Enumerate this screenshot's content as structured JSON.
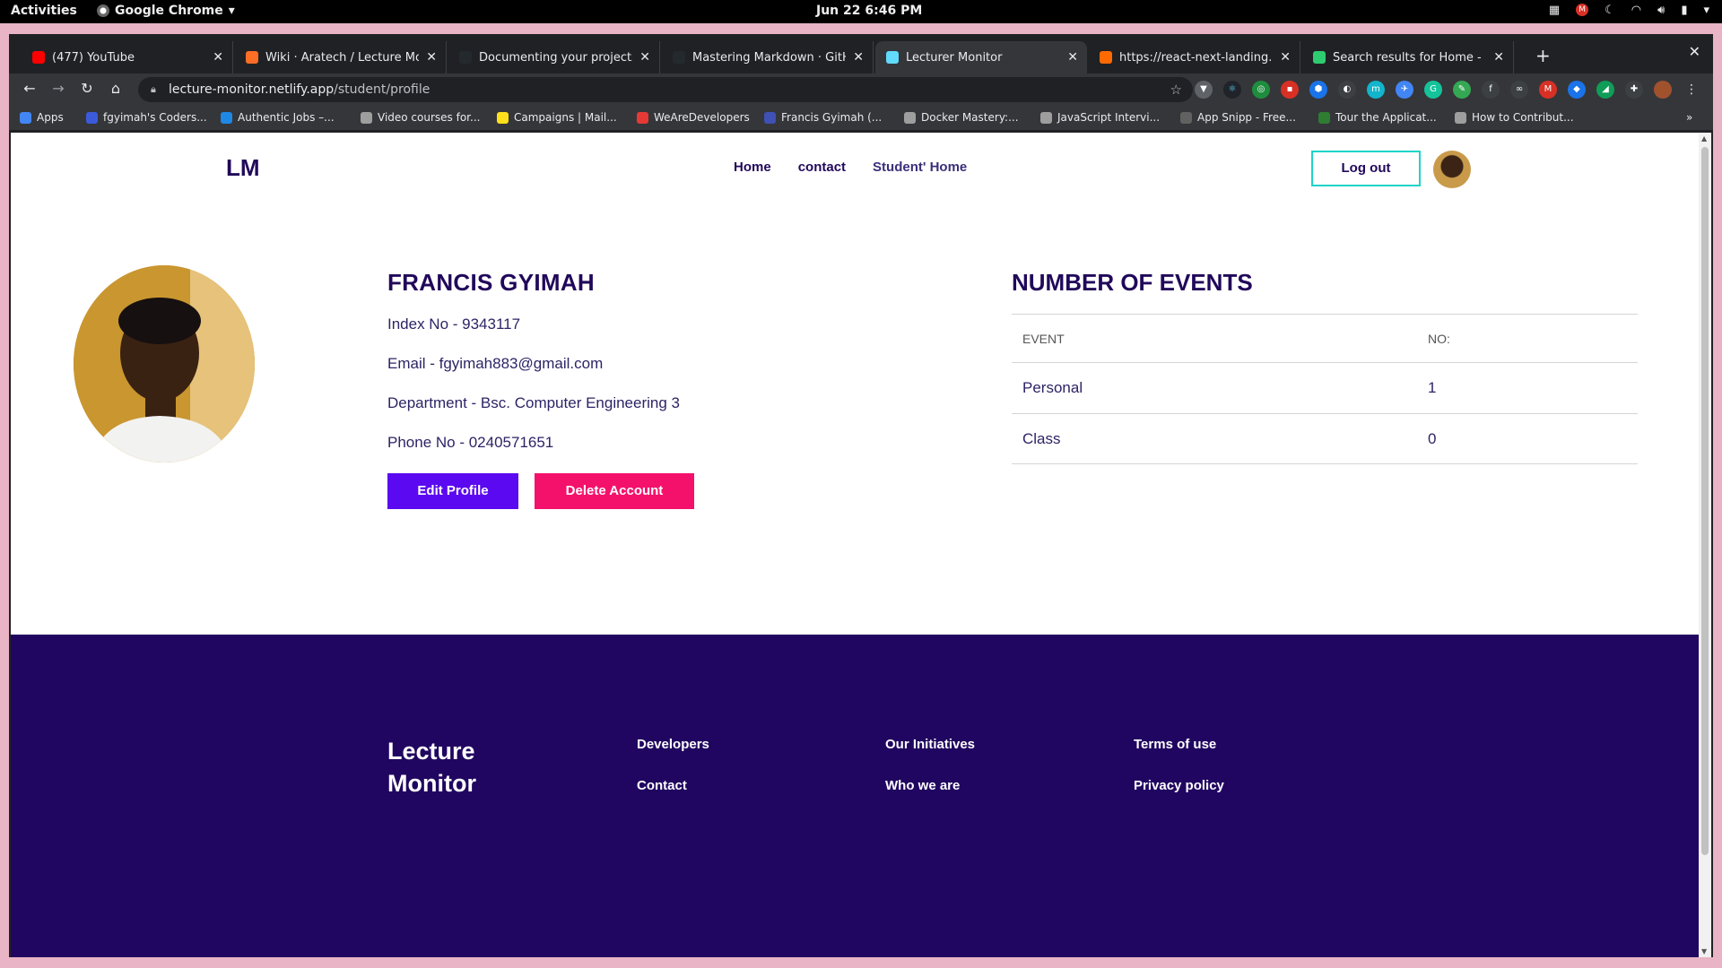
{
  "os": {
    "activities": "Activities",
    "app_name": "Google Chrome",
    "clock": "Jun 22  6:46 PM",
    "tray_badge": "M"
  },
  "browser": {
    "tabs": [
      {
        "title": "(477) YouTube",
        "color": "#ff0000"
      },
      {
        "title": "Wiki · Aratech / Lecture Monit",
        "color": "#fc6d26"
      },
      {
        "title": "Documenting your projects o",
        "color": "#24292e"
      },
      {
        "title": "Mastering Markdown · GitHub",
        "color": "#24292e"
      },
      {
        "title": "Lecturer Monitor",
        "color": "#61dafb"
      },
      {
        "title": "https://react-next-landing.re",
        "color": "#ff6a00"
      },
      {
        "title": "Search results for Home - Fla",
        "color": "#2ecc71"
      }
    ],
    "url_host": "lecture-monitor.netlify.app",
    "url_path": "/student/profile",
    "bookmarks": [
      {
        "label": "Apps",
        "color": "#4285f4"
      },
      {
        "label": "fgyimah's Coders...",
        "color": "#3b5bdb"
      },
      {
        "label": "Authentic Jobs –...",
        "color": "#1e88e5"
      },
      {
        "label": "Video courses for...",
        "color": "#9e9e9e"
      },
      {
        "label": "Campaigns | Mail...",
        "color": "#ffe01b"
      },
      {
        "label": "WeAreDevelopers",
        "color": "#e53935"
      },
      {
        "label": "Francis Gyimah (...",
        "color": "#3f51b5"
      },
      {
        "label": "Docker Mastery:...",
        "color": "#9e9e9e"
      },
      {
        "label": "JavaScript Intervi...",
        "color": "#9e9e9e"
      },
      {
        "label": "App Snipp - Free...",
        "color": "#616161"
      },
      {
        "label": "Tour the Applicat...",
        "color": "#2e7d32"
      },
      {
        "label": "How to Contribut...",
        "color": "#9e9e9e"
      }
    ]
  },
  "site": {
    "logo": "LM",
    "nav": {
      "home": "Home",
      "contact": "contact",
      "student_home": "Student' Home"
    },
    "logout": "Log out"
  },
  "profile": {
    "name": "FRANCIS GYIMAH",
    "index": "Index No - 9343117",
    "email": "Email - fgyimah883@gmail.com",
    "department": "Department - Bsc. Computer Engineering 3",
    "phone": "Phone No - 0240571651",
    "edit_button": "Edit Profile",
    "delete_button": "Delete Account"
  },
  "events": {
    "title": "NUMBER OF EVENTS",
    "headers": [
      "EVENT",
      "NO:"
    ],
    "rows": [
      {
        "event": "Personal",
        "count": "1"
      },
      {
        "event": "Class",
        "count": "0"
      }
    ]
  },
  "footer": {
    "brand": "Lecture Monitor",
    "links": {
      "developers": "Developers",
      "contact": "Contact",
      "initiatives": "Our Initiatives",
      "who": "Who we are",
      "terms": "Terms of use",
      "privacy": "Privacy policy"
    }
  },
  "colors": {
    "brand_dark": "#21085a",
    "edit": "#5b09f0",
    "delete": "#f4116b",
    "logout_border": "#1ed4c7",
    "footer_bg": "#200660"
  }
}
